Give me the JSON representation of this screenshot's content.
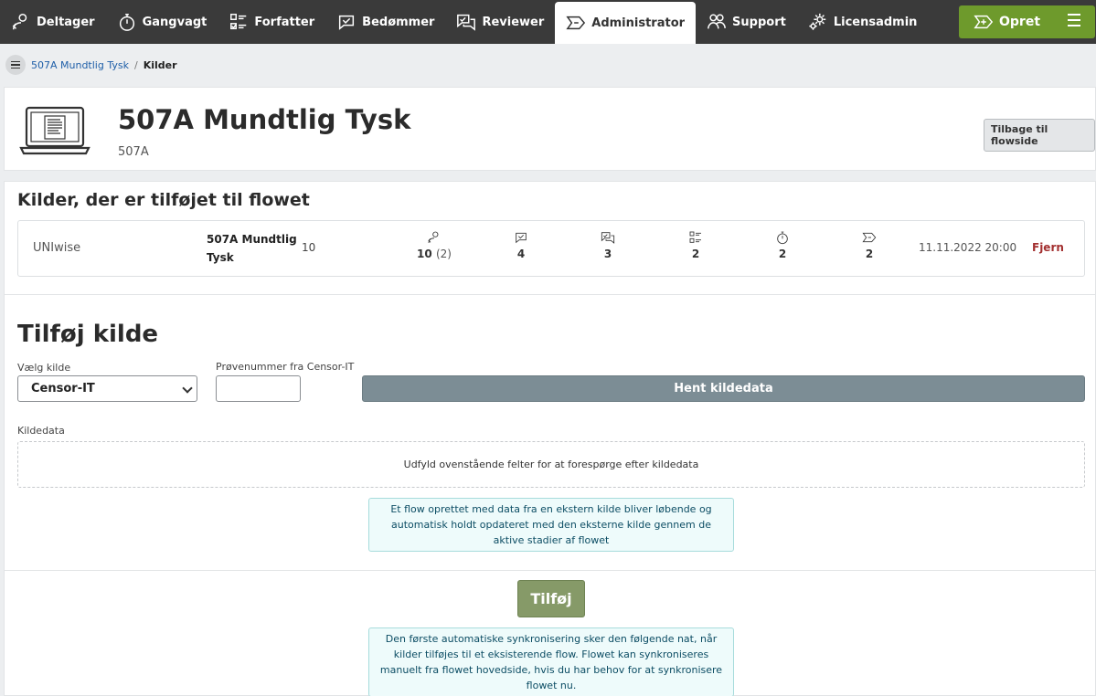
{
  "nav": {
    "items": [
      {
        "label": "Deltager",
        "icon": "participant-icon"
      },
      {
        "label": "Gangvagt",
        "icon": "stopwatch-icon"
      },
      {
        "label": "Forfatter",
        "icon": "checklist-icon"
      },
      {
        "label": "Bedømmer",
        "icon": "assess-bubble-icon"
      },
      {
        "label": "Reviewer",
        "icon": "review-bubbles-icon"
      },
      {
        "label": "Administrator",
        "icon": "flow-tag-icon"
      },
      {
        "label": "Support",
        "icon": "support-people-icon"
      },
      {
        "label": "Licensadmin",
        "icon": "gears-icon"
      }
    ],
    "active": "Administrator",
    "create_label": "Opret"
  },
  "breadcrumb": {
    "parent": "507A Mundtlig Tysk",
    "separator": "/",
    "current": "Kilder"
  },
  "header": {
    "title": "507A Mundtlig Tysk",
    "subtitle": "507A",
    "back_label": "Tilbage til flowside"
  },
  "sources": {
    "title": "Kilder, der er tilføjet til flowet",
    "rows": [
      {
        "provider": "UNIwise",
        "name": "507A Mundtlig Tysk",
        "count": "10",
        "participants": "10",
        "participants_extra": "(2)",
        "assessors": "4",
        "reviewers": "3",
        "authors": "2",
        "invigilators": "2",
        "admins": "2",
        "date": "11.11.2022 20:00",
        "remove_label": "Fjern"
      }
    ]
  },
  "add_source": {
    "title": "Tilføj kilde",
    "select_label": "Vælg kilde",
    "select_value": "Censor-IT",
    "number_label": "Prøvenummer fra Censor-IT",
    "number_value": "",
    "fetch_label": "Hent kildedata",
    "data_label": "Kildedata",
    "data_placeholder": "Udfyld ovenstående felter for at forespørge efter kildedata",
    "info_text": "Et flow oprettet med data fra en ekstern kilde bliver løbende og automatisk holdt opdateret med den eksterne kilde gennem de aktive stadier af flowet",
    "add_label": "Tilføj",
    "sync_info": "Den første automatiske synkronisering sker den følgende nat, når kilder tilføjes til et eksisterende flow. Flowet kan synkroniseres manuelt fra flowet hovedside, hvis du har behov for at synkronisere flowet nu."
  }
}
